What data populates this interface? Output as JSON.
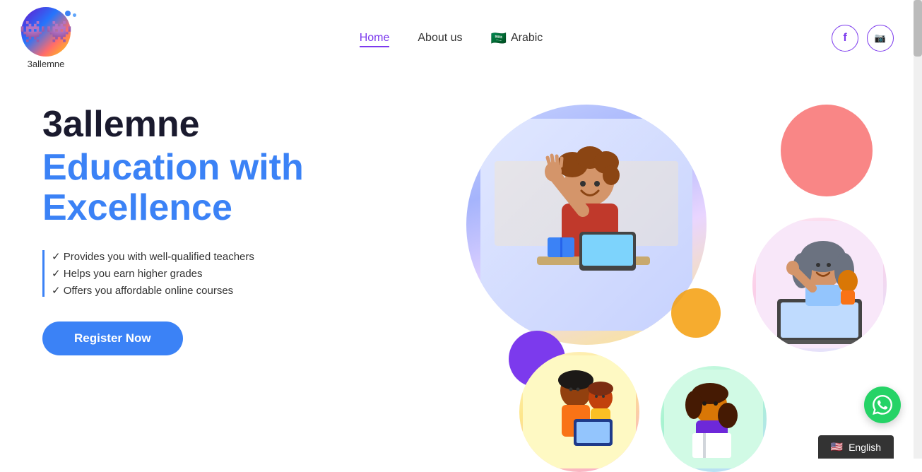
{
  "logo": {
    "name": "3allemne",
    "emoji": "👾"
  },
  "nav": {
    "links": [
      {
        "label": "Home",
        "active": true
      },
      {
        "label": "About us",
        "active": false
      },
      {
        "label": "Arabic",
        "active": false,
        "flag": "🇸🇦"
      }
    ],
    "social": [
      {
        "icon": "f",
        "name": "facebook"
      },
      {
        "icon": "📷",
        "name": "instagram"
      }
    ]
  },
  "hero": {
    "title_black": "3allemne",
    "title_blue_line1": "Education with",
    "title_blue_line2": "Excellence",
    "features": [
      "✓ Provides you with well-qualified teachers",
      "✓ Helps you earn higher grades",
      "✓ Offers you affordable online courses"
    ],
    "cta_label": "Register Now"
  },
  "footer": {
    "lang_label": "English",
    "lang_flag": "🇺🇸"
  },
  "whatsapp": {
    "icon": "💬"
  }
}
